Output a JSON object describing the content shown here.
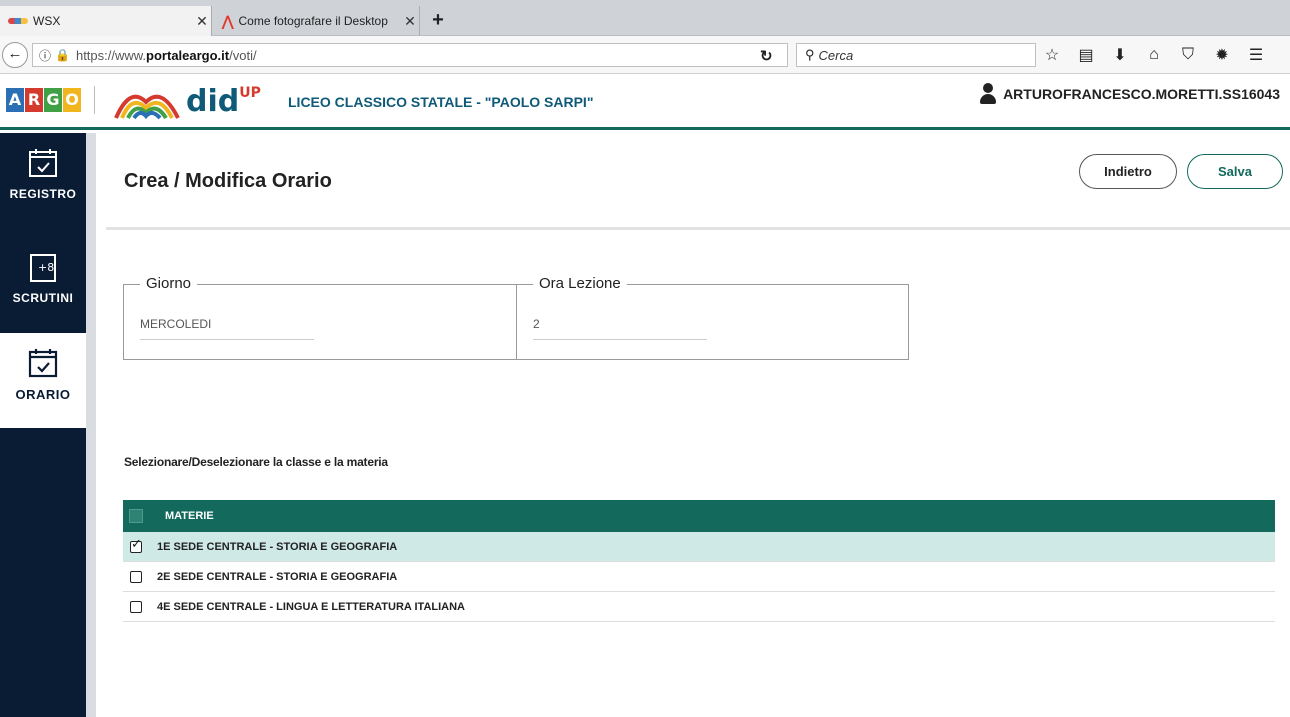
{
  "browser": {
    "tabs": [
      {
        "title": "WSX",
        "active": true
      },
      {
        "title": "Come fotografare il Desktop",
        "active": false
      }
    ],
    "new_tab": "+",
    "url": {
      "prefix": "https://www.",
      "host": "portaleargo.it",
      "path": "/voti/"
    },
    "search_placeholder": "Cerca"
  },
  "header": {
    "argo_letters": [
      "A",
      "R",
      "G",
      "O"
    ],
    "didup": "did",
    "didup_sup": "UP",
    "school": "LICEO CLASSICO STATALE - \"PAOLO SARPI\"",
    "user": "ARTUROFRANCESCO.MORETTI.SS16043"
  },
  "sidebar": {
    "items": [
      {
        "label": "REGISTRO",
        "icon": "calendar-check-icon",
        "active": false
      },
      {
        "label": "SCRUTINI",
        "icon": "scrutini-icon",
        "active": false
      },
      {
        "label": "ORARIO",
        "icon": "calendar-check-icon",
        "active": true
      }
    ]
  },
  "main": {
    "title": "Crea / Modifica Orario",
    "back_label": "Indietro",
    "save_label": "Salva",
    "giorno": {
      "label": "Giorno",
      "value": "MERCOLEDI"
    },
    "ora": {
      "label": "Ora Lezione",
      "value": "2"
    },
    "hint": "Selezionare/Deselezionare la classe e la materia",
    "table": {
      "header": "MATERIE",
      "rows": [
        {
          "text": "1E SEDE CENTRALE - STORIA E GEOGRAFIA",
          "checked": true
        },
        {
          "text": "2E SEDE CENTRALE - STORIA E GEOGRAFIA",
          "checked": false
        },
        {
          "text": "4E SEDE CENTRALE - LINGUA E LETTERATURA ITALIANA",
          "checked": false
        }
      ]
    }
  },
  "colors": {
    "accent": "#12695c",
    "sidebar": "#0a1b34",
    "selected_row": "#cfe9e7",
    "brand_blue": "#0f5a78"
  }
}
